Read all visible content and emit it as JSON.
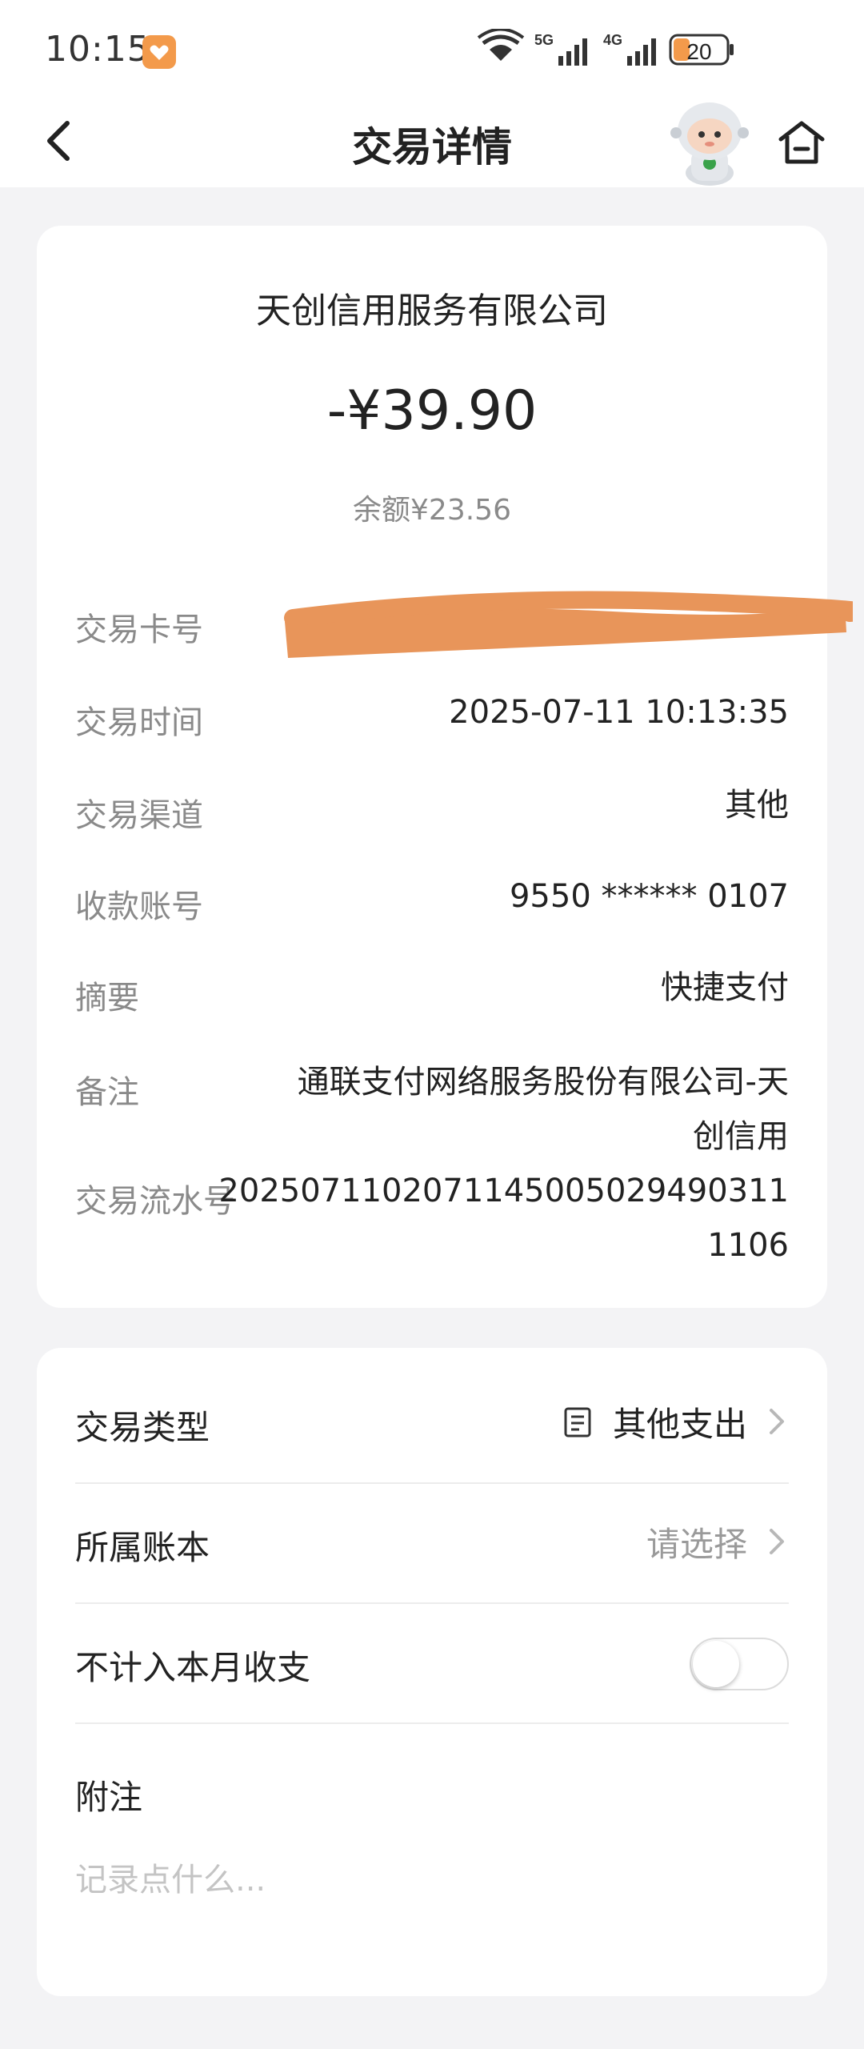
{
  "status_bar": {
    "time": "10:15",
    "network_1": "5G",
    "network_2": "4G",
    "battery": "20"
  },
  "header": {
    "title": "交易详情",
    "icons": [
      "back-arrow-icon",
      "robot-mascot-icon",
      "home-icon"
    ]
  },
  "summary": {
    "merchant": "天创信用服务有限公司",
    "amount": "-¥39.90",
    "balance": "余额¥23.56"
  },
  "details": {
    "card_no_label": "交易卡号",
    "time_label": "交易时间",
    "time_value": "2025-07-11 10:13:35",
    "channel_label": "交易渠道",
    "channel_value": "其他",
    "account_label": "收款账号",
    "account_value": "9550 ****** 0107",
    "summary_label": "摘要",
    "summary_value": "快捷支付",
    "remark_label": "备注",
    "remark_line1": "通联支付网络服务股份有限公司-天",
    "remark_line2": "创信用",
    "serial_label": "交易流水号",
    "serial_line1": "2025071102071145005029490311",
    "serial_line2": "1106"
  },
  "options": {
    "type_label": "交易类型",
    "type_value": "其他支出",
    "ledger_label": "所属账本",
    "ledger_placeholder": "请选择",
    "exclude_label": "不计入本月收支",
    "exclude_enabled": false,
    "note_label": "附注",
    "note_placeholder": "记录点什么..."
  },
  "colors": {
    "background": "#f3f3f5",
    "card": "#ffffff",
    "accent_orange": "#f39a4b",
    "redaction": "#e8955a",
    "label_gray": "#8a8a8a"
  }
}
